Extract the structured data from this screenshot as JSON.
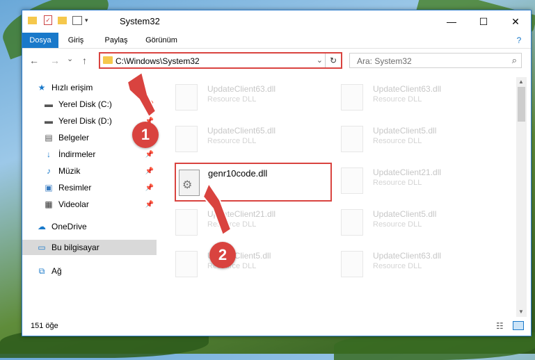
{
  "window": {
    "title": "System32",
    "controls": {
      "minimize": "—",
      "maximize": "☐",
      "close": "✕"
    }
  },
  "ribbon": {
    "tabs": [
      "Dosya",
      "Giriş",
      "Paylaş",
      "Görünüm"
    ],
    "help": "?"
  },
  "nav": {
    "back": "←",
    "forward": "→",
    "history": "⌄",
    "up": "↑",
    "address": "C:\\Windows\\System32",
    "address_dropdown": "⌄",
    "refresh": "↻",
    "search_placeholder": "Ara: System32",
    "search_icon": "⌕"
  },
  "sidebar": {
    "items": [
      {
        "label": "Hızlı erişim",
        "icon": "★",
        "color": "#1979ca"
      },
      {
        "label": "Yerel Disk (C:)",
        "icon": "▬",
        "color": "#555555",
        "pin": "📌"
      },
      {
        "label": "Yerel Disk (D:)",
        "icon": "▬",
        "color": "#555555",
        "pin": "📌"
      },
      {
        "label": "Belgeler",
        "icon": "▤",
        "color": "#555555",
        "pin": "📌"
      },
      {
        "label": "İndirmeler",
        "icon": "↓",
        "color": "#1979ca",
        "pin": "📌"
      },
      {
        "label": "Müzik",
        "icon": "♪",
        "color": "#1979ca",
        "pin": "📌"
      },
      {
        "label": "Resimler",
        "icon": "▣",
        "color": "#3a7cc1",
        "pin": "📌"
      },
      {
        "label": "Videolar",
        "icon": "▦",
        "color": "#333333",
        "pin": "📌"
      },
      {
        "label": "OneDrive",
        "icon": "☁",
        "color": "#1979ca"
      },
      {
        "label": "Bu bilgisayar",
        "icon": "▭",
        "color": "#1979ca"
      },
      {
        "label": "Ağ",
        "icon": "⧉",
        "color": "#1979ca"
      }
    ]
  },
  "files": {
    "faded": [
      {
        "name": "UpdateClient63.dll",
        "type": "Resource DLL"
      },
      {
        "name": "UpdateClient63.dll",
        "type": "Resource DLL"
      },
      {
        "name": "UpdateClient65.dll",
        "type": "Resource DLL"
      },
      {
        "name": "UpdateClient5.dll",
        "type": "Resource DLL"
      },
      {
        "name": "UpdateClient21.dll",
        "type": "Resource DLL"
      },
      {
        "name": "UpdateClient21.dll",
        "type": "Resource DLL"
      },
      {
        "name": "UpdateClient5.dll",
        "type": "Resource DLL"
      },
      {
        "name": "UpdateClient5.dll",
        "type": "Resource DLL"
      },
      {
        "name": "UpdateClient63.dll",
        "type": "Resource DLL"
      }
    ],
    "highlighted": {
      "name": "genr10code.dll"
    }
  },
  "status": {
    "count": "151 öğe"
  },
  "annotations": {
    "badge1": "1",
    "badge2": "2",
    "color": "#d9433f"
  }
}
